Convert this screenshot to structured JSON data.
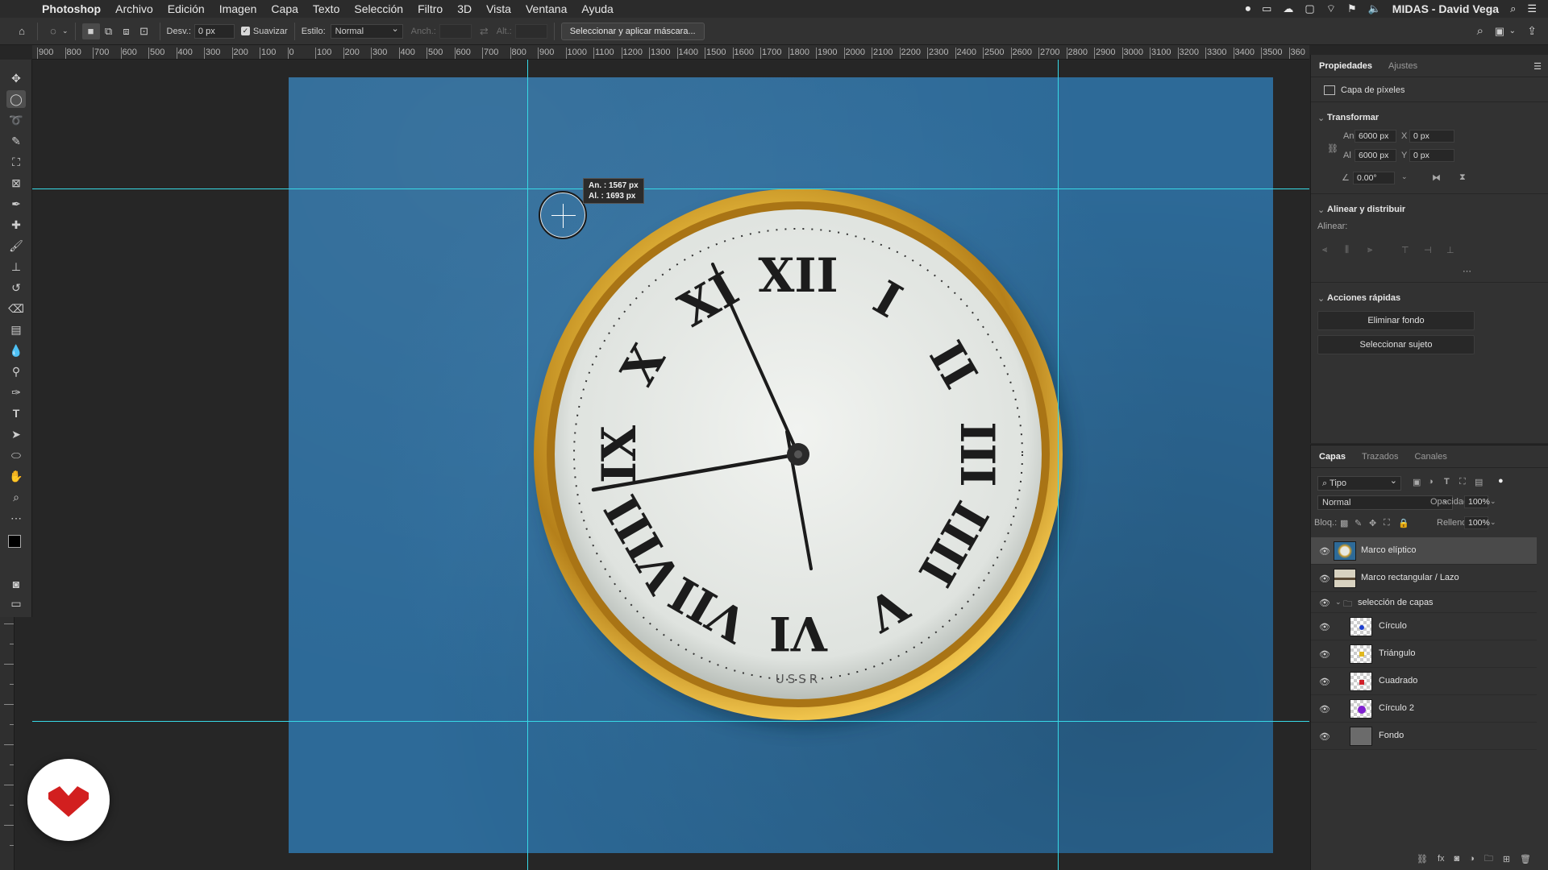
{
  "menubar": {
    "app_name": "Photoshop",
    "items": [
      "Archivo",
      "Edición",
      "Imagen",
      "Capa",
      "Texto",
      "Selección",
      "Filtro",
      "3D",
      "Vista",
      "Ventana",
      "Ayuda"
    ],
    "user": "MIDAS - David Vega"
  },
  "options": {
    "desv_label": "Desv.:",
    "desv_value": "0 px",
    "suavizar_label": "Suavizar",
    "estilo_label": "Estilo:",
    "estilo_value": "Normal",
    "anch_label": "Anch.:",
    "alt_label": "Alt.:",
    "mask_button": "Seleccionar y aplicar máscara..."
  },
  "ruler_labels": [
    "900",
    "800",
    "700",
    "600",
    "500",
    "400",
    "300",
    "200",
    "100",
    "0",
    "100",
    "200",
    "300",
    "400",
    "500",
    "600",
    "700",
    "800",
    "900",
    "1000",
    "1100",
    "1200",
    "1300",
    "1400",
    "1500",
    "1600",
    "1700",
    "1800",
    "1900",
    "2000",
    "2100",
    "2200",
    "2300",
    "2400",
    "2500",
    "2600",
    "2700",
    "2800",
    "2900",
    "3000",
    "3100",
    "3200",
    "3300",
    "3400",
    "3500",
    "360"
  ],
  "tooltip": {
    "width": "An. : 1567 px",
    "height": "Al. : 1693 px"
  },
  "clock_text": "USSR",
  "properties": {
    "tabs": [
      "Propiedades",
      "Ajustes"
    ],
    "layer_type": "Capa de píxeles",
    "transform_title": "Transformar",
    "w_label": "An",
    "w_value": "6000 px",
    "h_label": "Al",
    "h_value": "6000 px",
    "x_label": "X",
    "x_value": "0 px",
    "y_label": "Y",
    "y_value": "0 px",
    "angle_value": "0.00°",
    "align_title": "Alinear y distribuir",
    "align_label": "Alinear:",
    "quick_title": "Acciones rápidas",
    "btn_remove_bg": "Eliminar fondo",
    "btn_select_subject": "Seleccionar sujeto"
  },
  "layers_panel": {
    "tabs": [
      "Capas",
      "Trazados",
      "Canales"
    ],
    "filter_value": "Tipo",
    "blend_mode": "Normal",
    "opacity_label": "Opacidad:",
    "opacity_value": "100%",
    "lock_label": "Bloq.:",
    "fill_label": "Relleno:",
    "fill_value": "100%",
    "layers": [
      {
        "name": "Marco elíptico",
        "selected": true
      },
      {
        "name": "Marco rectangular / Lazo"
      },
      {
        "name": "selección de capas",
        "group": true
      },
      {
        "name": "Círculo",
        "dot": "#1d3fd0"
      },
      {
        "name": "Triángulo",
        "dot": "#e0b820"
      },
      {
        "name": "Cuadrado",
        "dot": "#d0202a"
      },
      {
        "name": "Círculo 2",
        "dot": "#8020d0"
      },
      {
        "name": "Fondo"
      }
    ]
  },
  "colors": {
    "guide": "#37d9e6",
    "canvas_blue": "#2d6a98",
    "gold": "#d4a227",
    "logo_red": "#d21f1f"
  }
}
